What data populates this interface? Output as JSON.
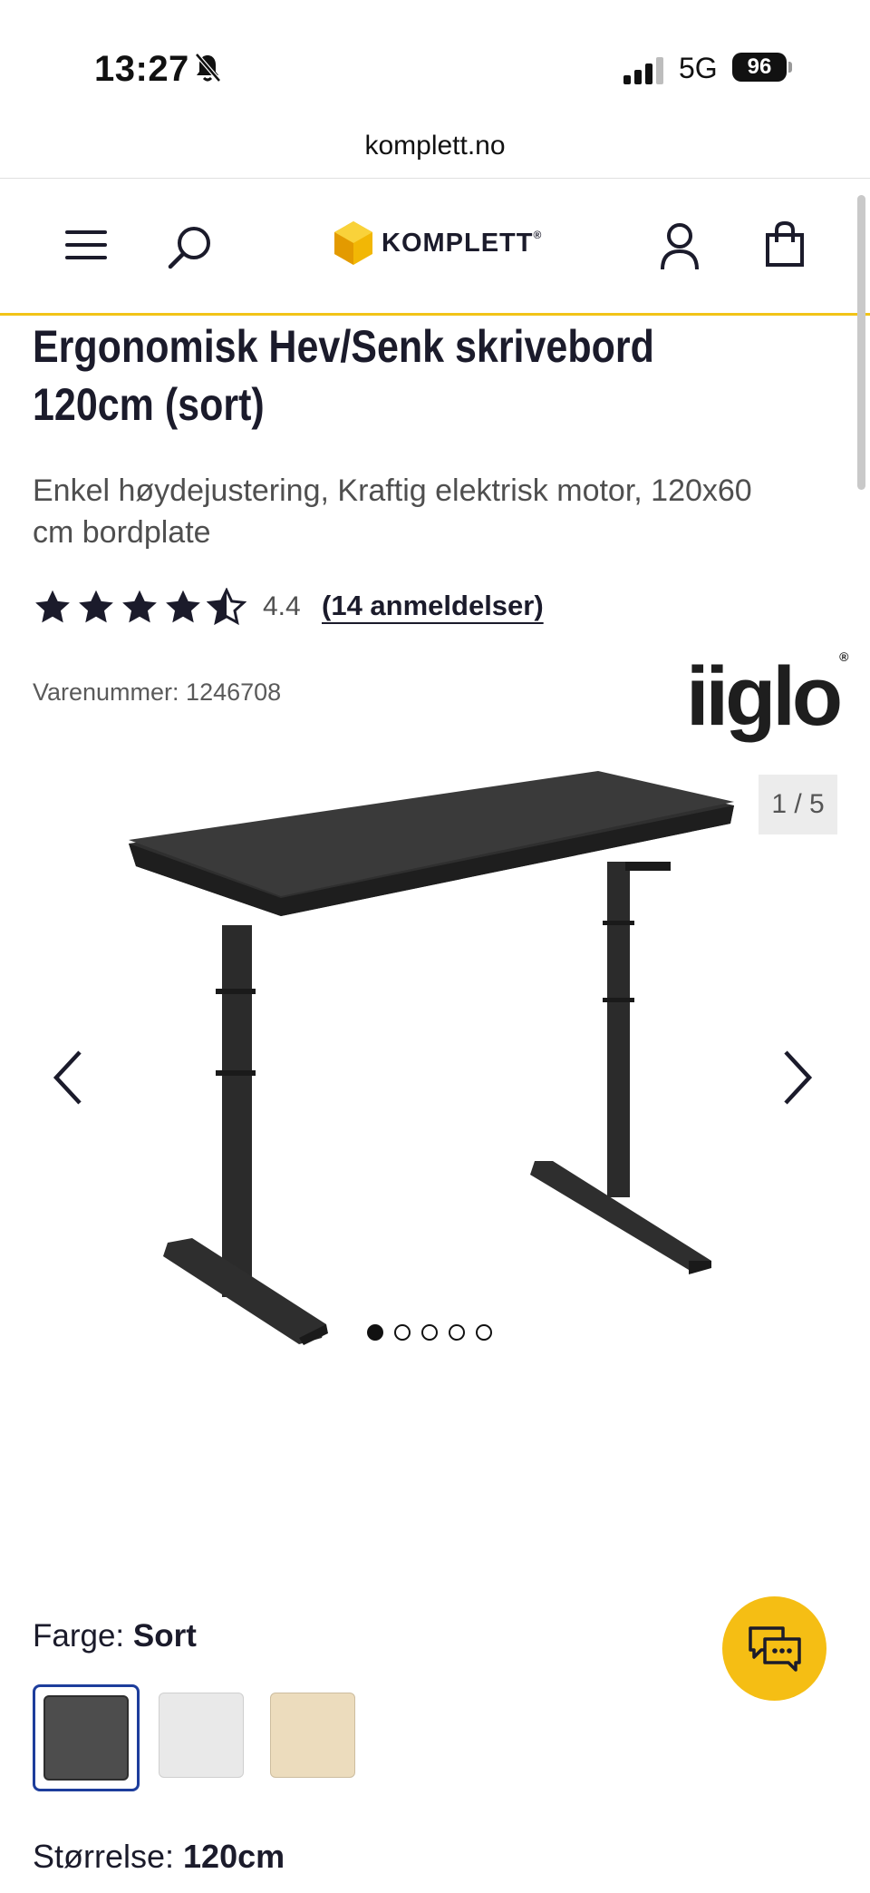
{
  "status_bar": {
    "time": "13:27",
    "network": "5G",
    "battery": "96"
  },
  "browser": {
    "url": "komplett.no"
  },
  "header": {
    "logo_text": "KOMPLETT",
    "logo_reg": "®",
    "icons": [
      "menu-icon",
      "search-icon",
      "account-icon",
      "cart-icon"
    ],
    "accent_color": "#f2c417"
  },
  "product": {
    "title_line1": "Ergonomisk Hev/Senk skrivebord",
    "title_line2": "120cm (sort)",
    "subtitle": "Enkel høydejustering, Kraftig elektrisk motor, 120x60 cm bordplate",
    "rating": 4.4,
    "rating_text": "4.4",
    "reviews_label": "(14 anmeldelser)",
    "sku_label": "Varenummer: 1246708",
    "brand": "iiglo",
    "brand_reg": "®"
  },
  "gallery": {
    "counter": "1 / 5",
    "current_index": 1,
    "total": 5
  },
  "options": {
    "color_label": "Farge: ",
    "color_value": "Sort",
    "swatches": [
      {
        "name": "Sort",
        "color": "#4d4d4d",
        "selected": true
      },
      {
        "name": "Hvit",
        "color": "#e9e9e9",
        "selected": false
      },
      {
        "name": "Eik",
        "color": "#ecdcbd",
        "selected": false
      }
    ],
    "size_label": "Størrelse: ",
    "size_value": "120cm"
  },
  "chat": {
    "icon": "chat-icon",
    "color": "#f5be14"
  }
}
